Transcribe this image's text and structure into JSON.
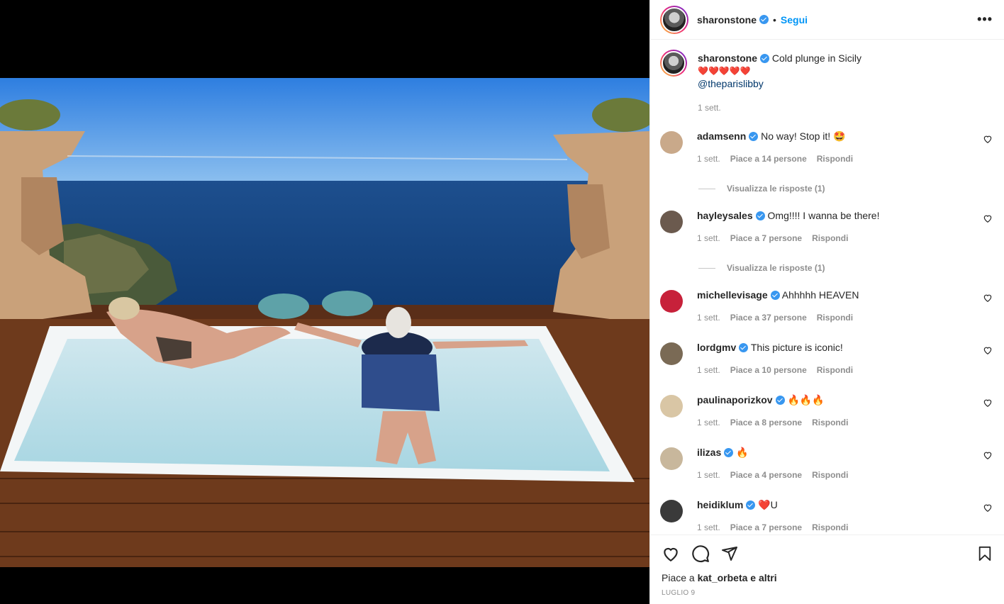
{
  "post": {
    "username": "sharonstone",
    "follow_label": "Segui",
    "separator": "•",
    "more_label": "•••",
    "caption_text": "Cold plunge in Sicily",
    "caption_hearts": "❤️❤️❤️❤️❤️",
    "caption_mention": "@theparislibby",
    "caption_time": "1 sett."
  },
  "comments": [
    {
      "username": "adamsenn",
      "text": "No way! Stop it! 🤩",
      "time": "1 sett.",
      "likes": "Piace a 14 persone",
      "reply": "Rispondi",
      "view_replies": "Visualizza le risposte (1)",
      "avatar_color": "#c9a98a"
    },
    {
      "username": "hayleysales",
      "text": "Omg!!!! I wanna be there!",
      "time": "1 sett.",
      "likes": "Piace a 7 persone",
      "reply": "Rispondi",
      "view_replies": "Visualizza le risposte (1)",
      "avatar_color": "#6b5a4e"
    },
    {
      "username": "michellevisage",
      "text": "Ahhhhh HEAVEN",
      "time": "1 sett.",
      "likes": "Piace a 37 persone",
      "reply": "Rispondi",
      "avatar_color": "#c7213a"
    },
    {
      "username": "lordgmv",
      "text": "This picture is iconic!",
      "time": "1 sett.",
      "likes": "Piace a 10 persone",
      "reply": "Rispondi",
      "avatar_color": "#7a6a55"
    },
    {
      "username": "paulinaporizkov",
      "text": "🔥🔥🔥",
      "time": "1 sett.",
      "likes": "Piace a 8 persone",
      "reply": "Rispondi",
      "avatar_color": "#d9c6a5"
    },
    {
      "username": "ilizas",
      "text": "🔥",
      "time": "1 sett.",
      "likes": "Piace a 4 persone",
      "reply": "Rispondi",
      "avatar_color": "#c8b79c"
    },
    {
      "username": "heidiklum",
      "text": "❤️U",
      "time": "1 sett.",
      "likes": "Piace a 7 persone",
      "reply": "Rispondi",
      "avatar_color": "#3a3a3a"
    }
  ],
  "footer": {
    "likes_prefix": "Piace a ",
    "likes_user": "kat_orbeta",
    "likes_suffix": " e altri",
    "date": "LUGLIO 9"
  },
  "icons": {
    "like": "heart-icon",
    "comment": "comment-icon",
    "share": "share-icon",
    "save": "bookmark-icon"
  }
}
